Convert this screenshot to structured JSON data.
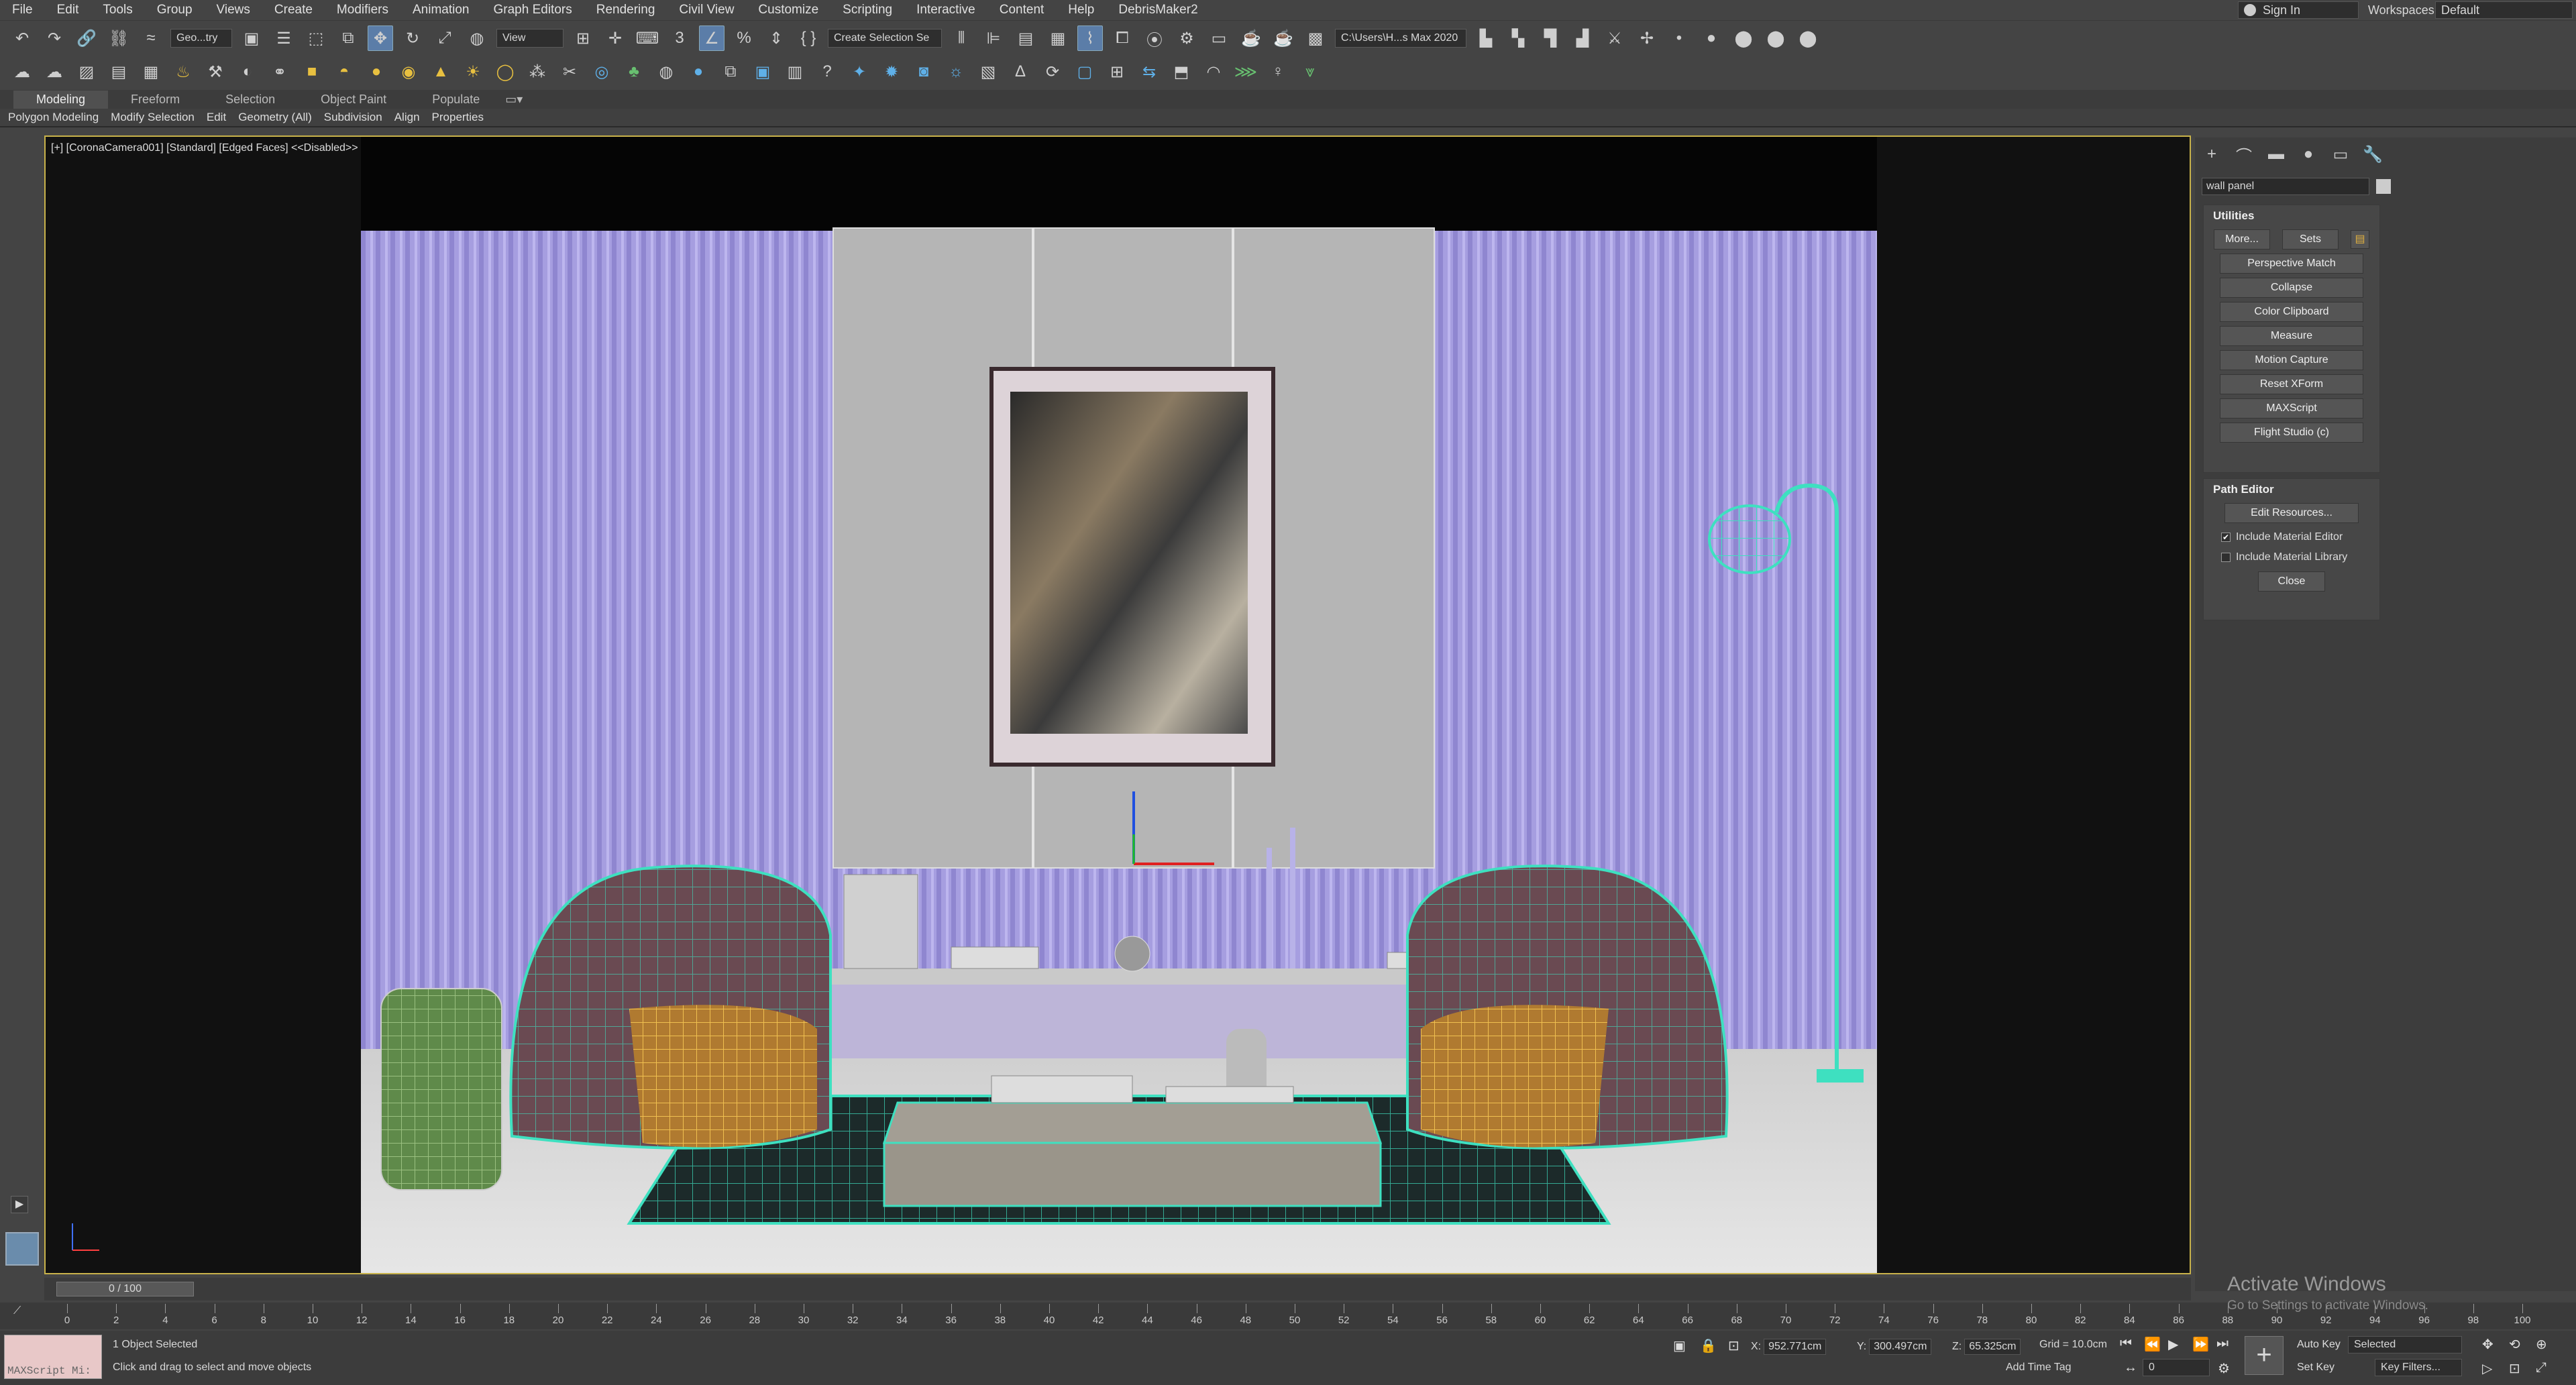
{
  "menu": [
    "File",
    "Edit",
    "Tools",
    "Group",
    "Views",
    "Create",
    "Modifiers",
    "Animation",
    "Graph Editors",
    "Rendering",
    "Civil View",
    "Customize",
    "Scripting",
    "Interactive",
    "Content",
    "Help",
    "DebrisMaker2"
  ],
  "signin": "Sign In",
  "workspaces_label": "Workspaces:",
  "workspace_value": "Default",
  "toolbar": {
    "selection_filter": "Geo...try",
    "ref_coord": "View",
    "named_sel": "Create Selection Se",
    "project_path": "C:\\Users\\H...s Max 2020"
  },
  "ribbon_tabs": [
    "Modeling",
    "Freeform",
    "Selection",
    "Object Paint",
    "Populate"
  ],
  "ribbon_items": [
    "Polygon Modeling",
    "Modify Selection",
    "Edit",
    "Geometry (All)",
    "Subdivision",
    "Align",
    "Properties"
  ],
  "viewport_label": "[+] [CoronaCamera001] [Standard] [Edged Faces] <<Disabled>>",
  "command_panel": {
    "object_name": "wall panel",
    "utilities_title": "Utilities",
    "more": "More...",
    "sets": "Sets",
    "utility_buttons": [
      "Perspective Match",
      "Collapse",
      "Color Clipboard",
      "Measure",
      "Motion Capture",
      "Reset XForm",
      "MAXScript",
      "Flight Studio (c)"
    ],
    "path_editor_title": "Path Editor",
    "edit_resources": "Edit Resources...",
    "include_mat_editor": "Include Material Editor",
    "include_mat_library": "Include Material Library",
    "close": "Close"
  },
  "timeslider": "0 / 100",
  "ruler_ticks": [
    "0",
    "2",
    "4",
    "6",
    "8",
    "10",
    "12",
    "14",
    "16",
    "18",
    "20",
    "22",
    "24",
    "26",
    "28",
    "30",
    "32",
    "34",
    "36",
    "38",
    "40",
    "42",
    "44",
    "46",
    "48",
    "50",
    "52",
    "54",
    "56",
    "58",
    "60",
    "62",
    "64",
    "66",
    "68",
    "70",
    "72",
    "74",
    "76",
    "78",
    "80",
    "82",
    "84",
    "86",
    "88",
    "90",
    "92",
    "94",
    "96",
    "98",
    "100"
  ],
  "status": {
    "maxscript": "MAXScript Mi:",
    "selected": "1 Object Selected",
    "prompt": "Click and drag to select and move objects",
    "x_label": "X:",
    "x": "952.771cm",
    "y_label": "Y:",
    "y": "300.497cm",
    "z_label": "Z:",
    "z": "65.325cm",
    "grid": "Grid = 10.0cm",
    "add_time_tag": "Add Time Tag",
    "auto_key": "Auto Key",
    "set_key": "Set Key",
    "selected_drop": "Selected",
    "key_filters": "Key Filters...",
    "frame": "0"
  },
  "activate": {
    "title": "Activate Windows",
    "sub": "Go to Settings to activate Windows."
  }
}
